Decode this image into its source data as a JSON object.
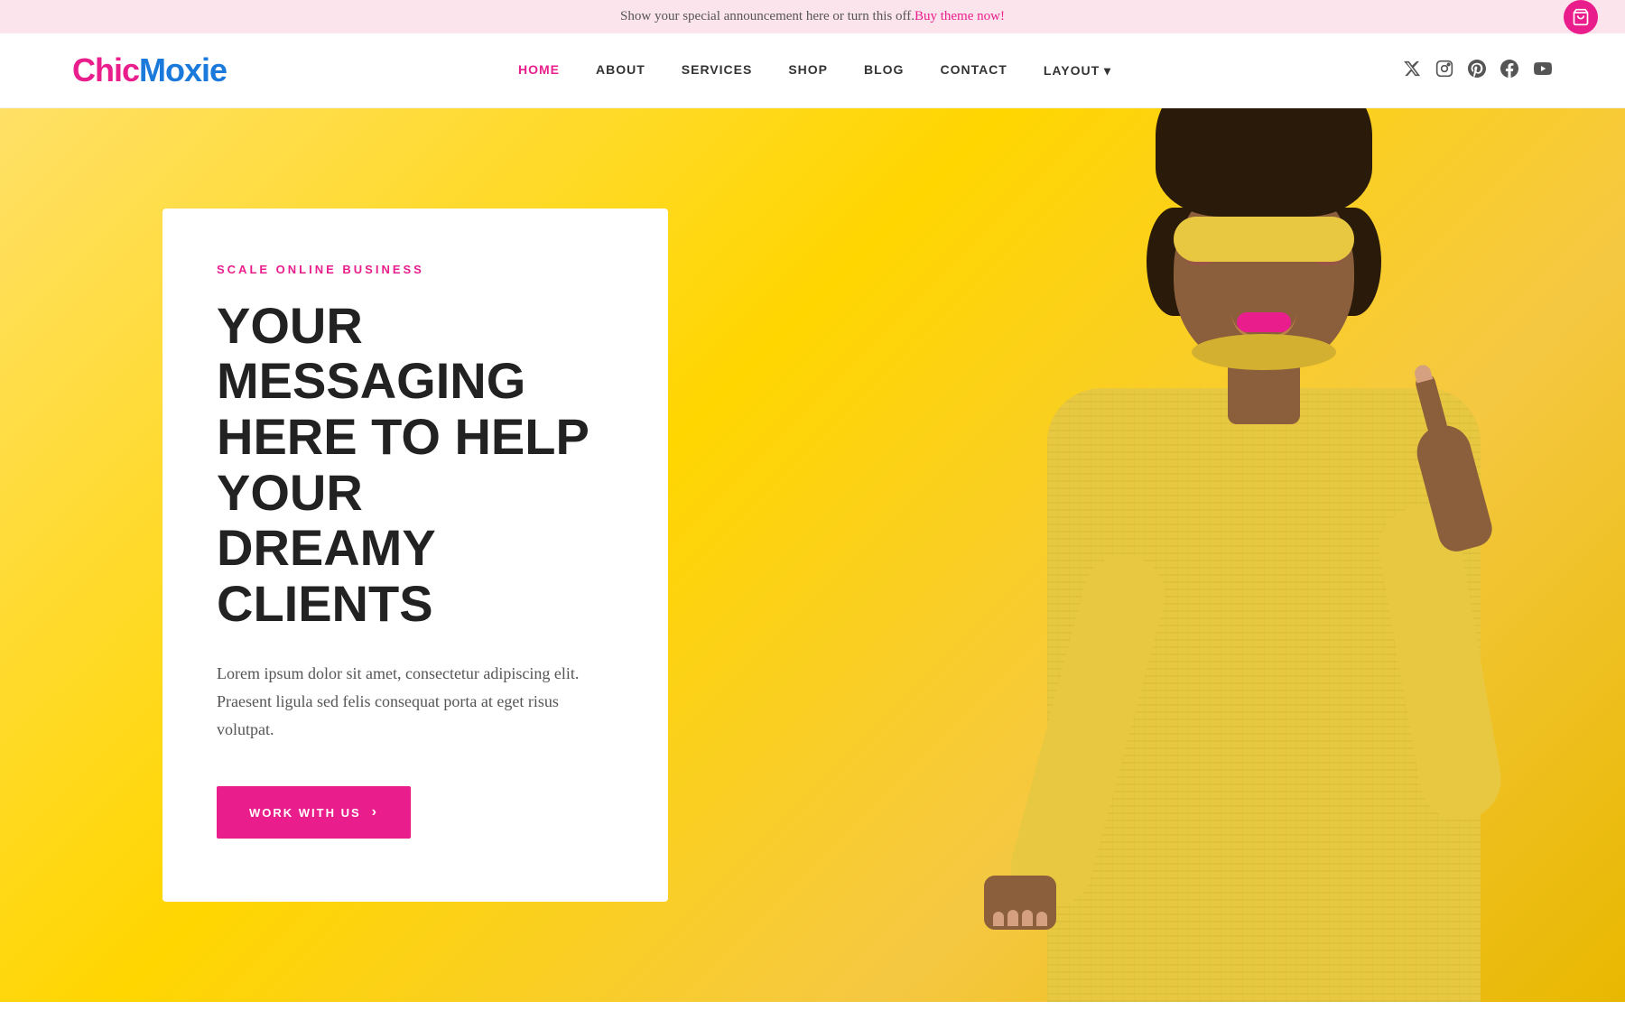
{
  "announcement": {
    "text": "Show your special announcement here or turn this off. ",
    "link_text": "Buy theme now!",
    "link_url": "#"
  },
  "logo": {
    "chic": "Chic",
    "moxie": "Moxie"
  },
  "nav": {
    "items": [
      {
        "label": "HOME",
        "active": true
      },
      {
        "label": "ABOUT",
        "active": false
      },
      {
        "label": "SERVICES",
        "active": false
      },
      {
        "label": "SHOP",
        "active": false
      },
      {
        "label": "BLOG",
        "active": false
      },
      {
        "label": "CONTACT",
        "active": false
      },
      {
        "label": "LAYOUT ▾",
        "active": false
      }
    ]
  },
  "social": {
    "items": [
      {
        "name": "twitter",
        "symbol": "𝕏"
      },
      {
        "name": "instagram",
        "symbol": "◎"
      },
      {
        "name": "pinterest",
        "symbol": "𝙿"
      },
      {
        "name": "facebook",
        "symbol": "f"
      },
      {
        "name": "youtube",
        "symbol": "▶"
      }
    ]
  },
  "hero": {
    "subtitle": "SCALE ONLINE BUSINESS",
    "heading_line1": "YOUR MESSAGING",
    "heading_line2": "HERE TO HELP YOUR",
    "heading_line3": "DREAMY CLIENTS",
    "description": "Lorem ipsum dolor sit amet, consectetur adipiscing elit. Praesent ligula sed felis consequat porta at eget risus volutpat.",
    "cta_label": "WORK WITH US",
    "cta_arrow": "›"
  },
  "colors": {
    "pink": "#e91e8c",
    "yellow": "#ffd600",
    "dark": "#222222",
    "text_muted": "#555555",
    "white": "#ffffff"
  }
}
